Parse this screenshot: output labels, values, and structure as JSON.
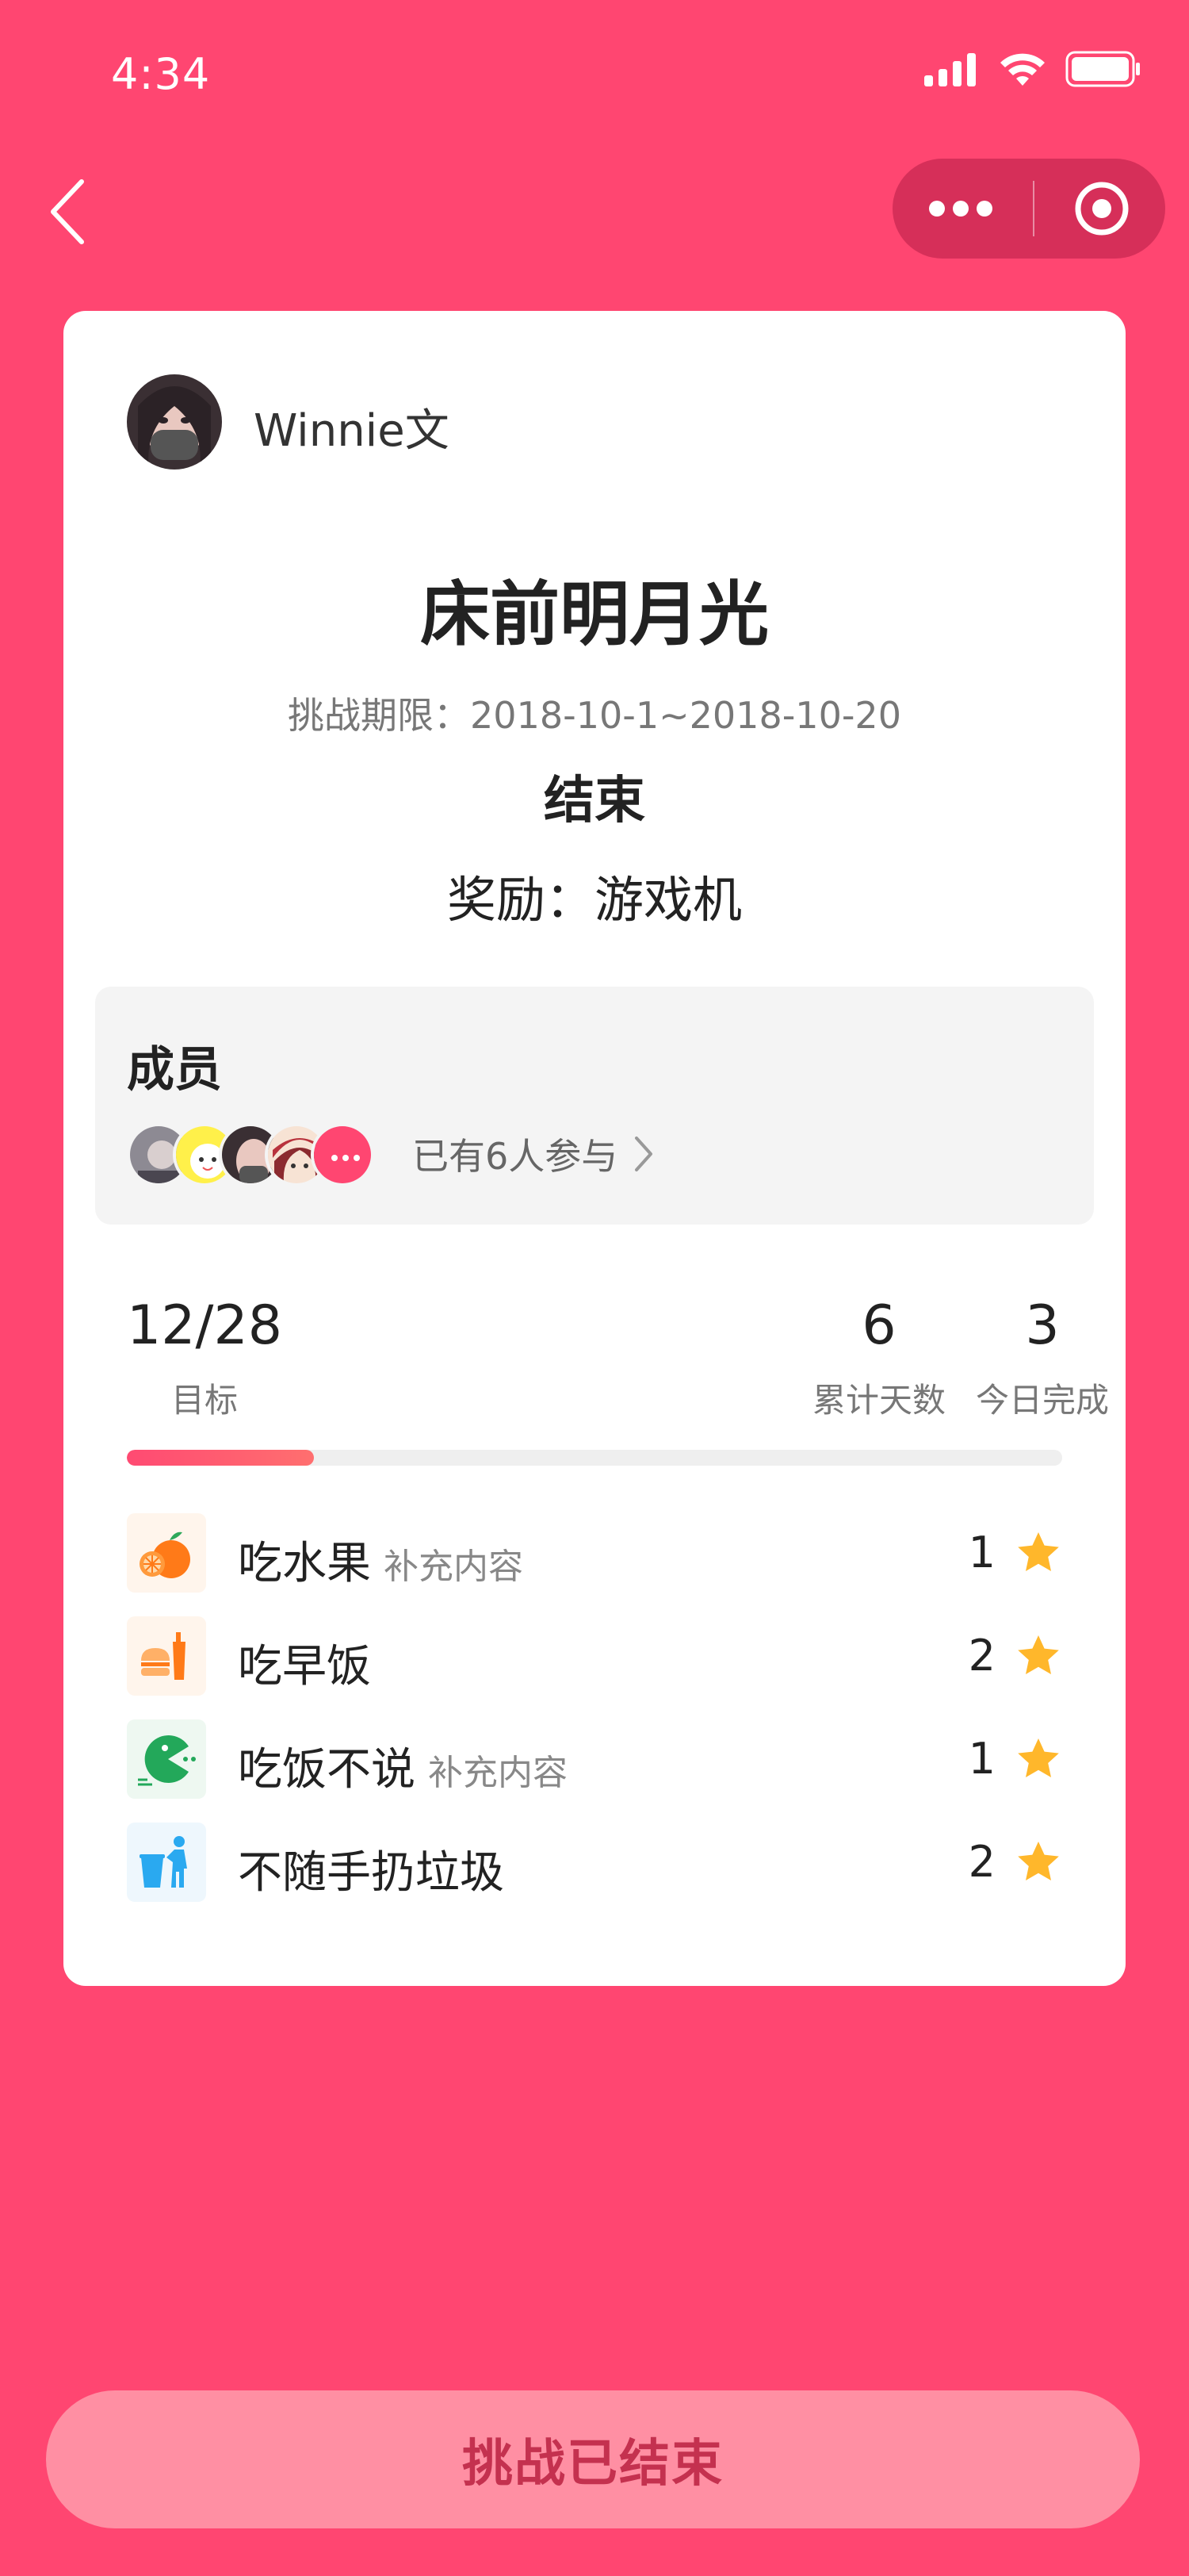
{
  "status_bar": {
    "time": "4:34"
  },
  "card": {
    "username": "Winnie文",
    "title": "床前明月光",
    "period": "挑战期限：2018-10-1~2018-10-20",
    "status": "结束",
    "reward": "奖励：游戏机"
  },
  "members": {
    "title": "成员",
    "count_text": "已有6人参与"
  },
  "stats": {
    "goal_value": "12/28",
    "goal_label": "目标",
    "days_value": "6",
    "days_label": "累计天数",
    "today_value": "3",
    "today_label": "今日完成",
    "progress": 0.2
  },
  "tasks": [
    {
      "name": "吃水果",
      "note": "补充内容",
      "count": "1",
      "icon": "orange-icon"
    },
    {
      "name": "吃早饭",
      "note": "",
      "count": "2",
      "icon": "breakfast-icon"
    },
    {
      "name": "吃饭不说",
      "note": "补充内容",
      "count": "1",
      "icon": "pacman-icon"
    },
    {
      "name": "不随手扔垃圾",
      "note": "",
      "count": "2",
      "icon": "trash-person-icon"
    }
  ],
  "button": {
    "label": "挑战已结束"
  },
  "colors": {
    "background": "#FF4671",
    "accent": "#FF4A72",
    "star": "#FFB72B"
  }
}
